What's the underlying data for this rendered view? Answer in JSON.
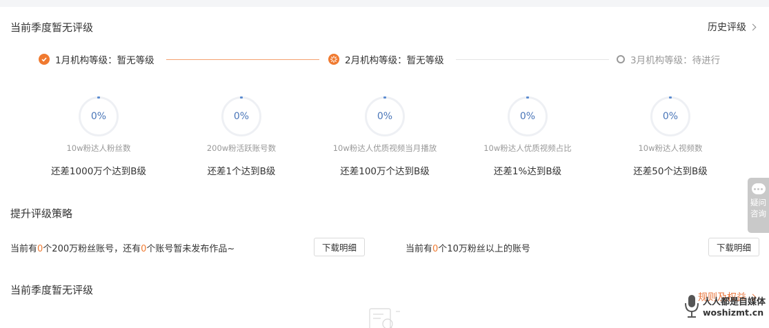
{
  "header": {
    "title": "当前季度暂无评级",
    "history_link": "历史评级"
  },
  "steps": [
    {
      "label": "1月机构等级：暂无等级",
      "status": "done"
    },
    {
      "label": "2月机构等级：暂无等级",
      "status": "current"
    },
    {
      "label": "3月机构等级：待进行",
      "status": "pending"
    }
  ],
  "metrics": [
    {
      "percent": "0%",
      "label": "10w粉达人粉丝数",
      "gap": "还差1000万个达到B级"
    },
    {
      "percent": "0%",
      "label": "200w粉活跃账号数",
      "gap": "还差1个达到B级"
    },
    {
      "percent": "0%",
      "label": "10w粉达人优质视频当月播放",
      "gap": "还差100万个达到B级"
    },
    {
      "percent": "0%",
      "label": "10w粉达人优质视频占比",
      "gap": "还差1%达到B级"
    },
    {
      "percent": "0%",
      "label": "10w粉达人视频数",
      "gap": "还差50个达到B级"
    }
  ],
  "strategy": {
    "title": "提升评级策略",
    "left": {
      "p1": "当前有",
      "n1": "0",
      "p2": "个200万粉丝账号，还有",
      "n2": "0",
      "p3": "个账号暂未发布作品~",
      "button": "下载明细"
    },
    "right": {
      "p1": "当前有",
      "n1": "0",
      "p2": "个10万粉丝以上的账号",
      "button": "下载明细"
    }
  },
  "section2": {
    "title": "当前季度暂无评级",
    "rules_link": "规则及权益"
  },
  "side_widget": {
    "line1": "疑问",
    "line2": "咨询"
  },
  "watermark": {
    "cn": "人人都是自媒体",
    "en": "woshizmt.cn"
  },
  "colors": {
    "accent": "#f07a30",
    "ring_text": "#4a76b8",
    "muted": "#999999"
  }
}
